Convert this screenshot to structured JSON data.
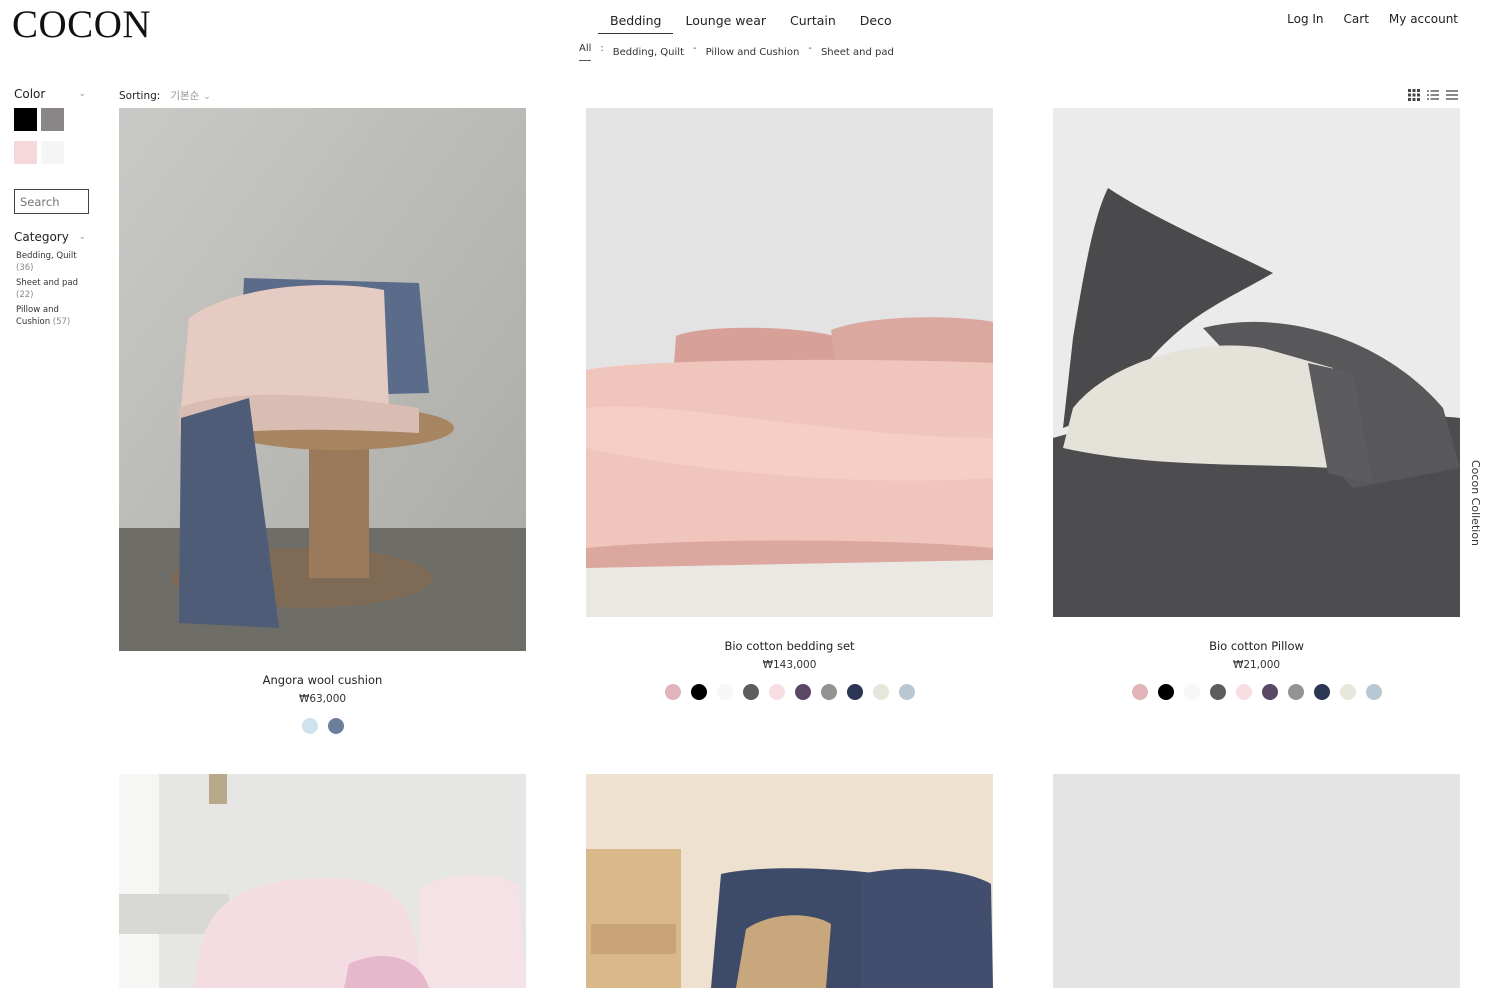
{
  "brand": "COCON",
  "nav": {
    "items": [
      "Bedding",
      "Lounge wear",
      "Curtain",
      "Deco"
    ],
    "sub": {
      "all": "All",
      "colon": ":",
      "dash": "-",
      "items": [
        "Bedding, Quilt",
        "Pillow and Cushion",
        "Sheet and pad"
      ]
    }
  },
  "user": {
    "login": "Log In",
    "cart": "Cart",
    "account": "My account"
  },
  "sidebar": {
    "color_title": "Color",
    "swatches": [
      "#000000",
      "#8a8687",
      "#f6d8dc",
      "#f5f5f5"
    ],
    "search_placeholder": "Search",
    "category_title": "Category",
    "categories": [
      {
        "name": "Bedding, Quilt",
        "count": "(36)"
      },
      {
        "name": "Sheet and pad",
        "count": "(22)"
      },
      {
        "name": "Pillow and Cushion",
        "count": "(57)"
      }
    ]
  },
  "sorting": {
    "label": "Sorting:",
    "value": "기본순"
  },
  "side_label": "Cocon Colletion",
  "products": [
    {
      "name": "Angora wool cushion",
      "price": "₩63,000",
      "colors": [
        "#cfe3ee",
        "#6b7f9c"
      ]
    },
    {
      "name": "Bio cotton bedding set",
      "price": "₩143,000",
      "colors": [
        "#e0b4b9",
        "#000000",
        "#f7f7f7",
        "#5d5c5f",
        "#f8dde1",
        "#5a4766",
        "#939393",
        "#2b3652",
        "#e4e7d9",
        "#b9c7d2"
      ]
    },
    {
      "name": "Bio cotton Pillow",
      "price": "₩21,000",
      "colors": [
        "#e0b4b9",
        "#000000",
        "#f7f7f7",
        "#5d5c5f",
        "#f8dde1",
        "#5a4766",
        "#939393",
        "#2b3652",
        "#e4e7d9",
        "#b9c7d2"
      ]
    }
  ]
}
